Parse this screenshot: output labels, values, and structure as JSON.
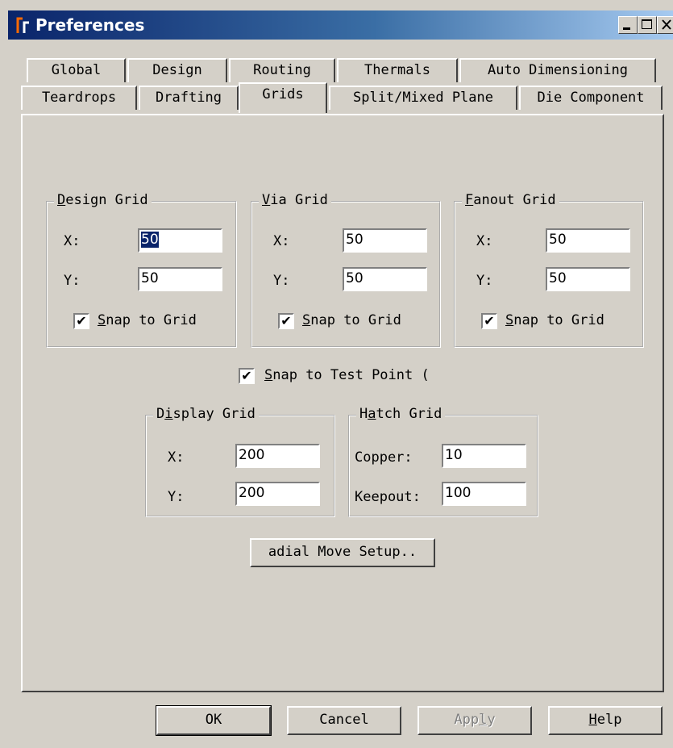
{
  "window": {
    "title": "Preferences"
  },
  "tabs_row1": [
    {
      "label": "Global"
    },
    {
      "label": "Design"
    },
    {
      "label": "Routing"
    },
    {
      "label": "Thermals"
    },
    {
      "label": "Auto Dimensioning"
    }
  ],
  "tabs_row2": [
    {
      "label": "Teardrops"
    },
    {
      "label": "Drafting"
    },
    {
      "label": "Grids"
    },
    {
      "label": "Split/Mixed Plane"
    },
    {
      "label": "Die Component"
    }
  ],
  "active_tab": "Grids",
  "design_grid": {
    "title_first": "D",
    "title_rest": "esign Grid",
    "x_label": "X:",
    "y_label": "Y:",
    "x": "50",
    "y": "50",
    "snap_first": "S",
    "snap_rest": "nap to Grid",
    "snap": true
  },
  "via_grid": {
    "title_first": "V",
    "title_rest": "ia Grid",
    "x_label": "X:",
    "y_label": "Y:",
    "x": "50",
    "y": "50",
    "snap_first": "S",
    "snap_rest": "nap to Grid",
    "snap": true
  },
  "fanout_grid": {
    "title_first": "F",
    "title_rest": "anout Grid",
    "x_label": "X:",
    "y_label": "Y:",
    "x": "50",
    "y": "50",
    "snap_first": "S",
    "snap_rest": "nap to Grid",
    "snap": true
  },
  "test_point": {
    "first": "S",
    "rest": "nap to Test Point (",
    "checked": true
  },
  "display_grid": {
    "title_pre": "D",
    "title_u": "i",
    "title_rest": "splay Grid",
    "x_label": "X:",
    "y_label": "Y:",
    "x": "200",
    "y": "200"
  },
  "hatch_grid": {
    "title_pre": "H",
    "title_u": "a",
    "title_rest": "tch Grid",
    "copper_label": "Copper:",
    "keepout_label": "Keepout:",
    "copper": "10",
    "keepout": "100"
  },
  "radial_button": "adial Move Setup..",
  "buttons": {
    "ok": "OK",
    "cancel": "Cancel",
    "apply_pre": "App",
    "apply_u": "l",
    "apply_rest": "y",
    "help_u": "H",
    "help_rest": "elp"
  },
  "colors": {
    "face": "#d4d0c8",
    "title_start": "#0a246a",
    "title_end": "#a6caf0"
  }
}
